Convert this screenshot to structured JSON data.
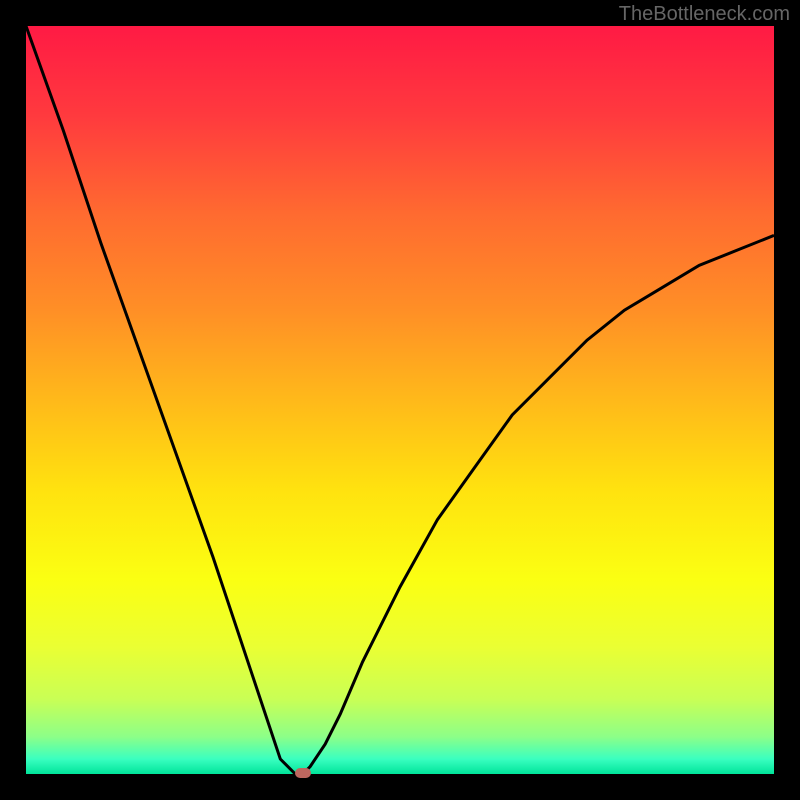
{
  "watermark": "TheBottleneck.com",
  "chart_data": {
    "type": "line",
    "title": "",
    "xlabel": "",
    "ylabel": "",
    "xlim": [
      0,
      100
    ],
    "ylim": [
      0,
      100
    ],
    "grid": false,
    "series": [
      {
        "name": "bottleneck-curve",
        "x": [
          0,
          5,
          10,
          15,
          20,
          25,
          30,
          34,
          36,
          37,
          38,
          40,
          42,
          45,
          50,
          55,
          60,
          65,
          70,
          75,
          80,
          85,
          90,
          95,
          100
        ],
        "values": [
          100,
          86,
          71,
          57,
          43,
          29,
          14,
          2,
          0,
          0,
          1,
          4,
          8,
          15,
          25,
          34,
          41,
          48,
          53,
          58,
          62,
          65,
          68,
          70,
          72
        ]
      }
    ],
    "marker": {
      "x": 37,
      "y": 0
    },
    "gradient_stops": [
      {
        "offset": 0.0,
        "color": "#ff1a44"
      },
      {
        "offset": 0.12,
        "color": "#ff3a3e"
      },
      {
        "offset": 0.25,
        "color": "#ff6a30"
      },
      {
        "offset": 0.38,
        "color": "#ff8f26"
      },
      {
        "offset": 0.5,
        "color": "#ffb91a"
      },
      {
        "offset": 0.62,
        "color": "#ffe20f"
      },
      {
        "offset": 0.74,
        "color": "#fbff12"
      },
      {
        "offset": 0.83,
        "color": "#eaff33"
      },
      {
        "offset": 0.9,
        "color": "#c9ff55"
      },
      {
        "offset": 0.95,
        "color": "#8dff88"
      },
      {
        "offset": 0.98,
        "color": "#3affc0"
      },
      {
        "offset": 1.0,
        "color": "#00e49a"
      }
    ]
  }
}
